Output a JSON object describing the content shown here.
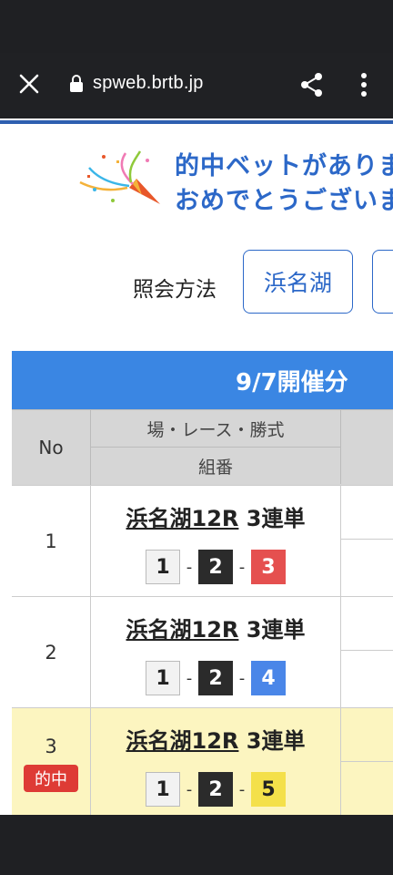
{
  "browser": {
    "url": "spweb.brtb.jp"
  },
  "banner": {
    "line1": "的中ベットがありま",
    "line2": "おめでとうございま"
  },
  "search": {
    "method_label": "照会方法",
    "venue_button": "浜名湖"
  },
  "table": {
    "date_header": "9/7開催分",
    "col_no": "No",
    "col_race": "場・レース・勝式",
    "col_combo": "組番",
    "rows": [
      {
        "no": "1",
        "venue": "浜名湖12R",
        "bet_type": "3連単",
        "combo": [
          "1",
          "2",
          "3"
        ],
        "hit": false
      },
      {
        "no": "2",
        "venue": "浜名湖12R",
        "bet_type": "3連単",
        "combo": [
          "1",
          "2",
          "4"
        ],
        "hit": false
      },
      {
        "no": "3",
        "venue": "浜名湖12R",
        "bet_type": "3連単",
        "combo": [
          "1",
          "2",
          "5"
        ],
        "hit": true,
        "hit_label": "的中"
      }
    ]
  },
  "boat_colors": {
    "1": {
      "bg": "#f2f2f2",
      "fg": "#222222",
      "border": "#bbbbbb"
    },
    "2": {
      "bg": "#2b2b2b",
      "fg": "#ffffff",
      "border": "#2b2b2b"
    },
    "3": {
      "bg": "#e5504f",
      "fg": "#ffffff",
      "border": "#e5504f"
    },
    "4": {
      "bg": "#4a86e8",
      "fg": "#ffffff",
      "border": "#4a86e8"
    },
    "5": {
      "bg": "#f4e04a",
      "fg": "#222222",
      "border": "#f4e04a"
    }
  }
}
